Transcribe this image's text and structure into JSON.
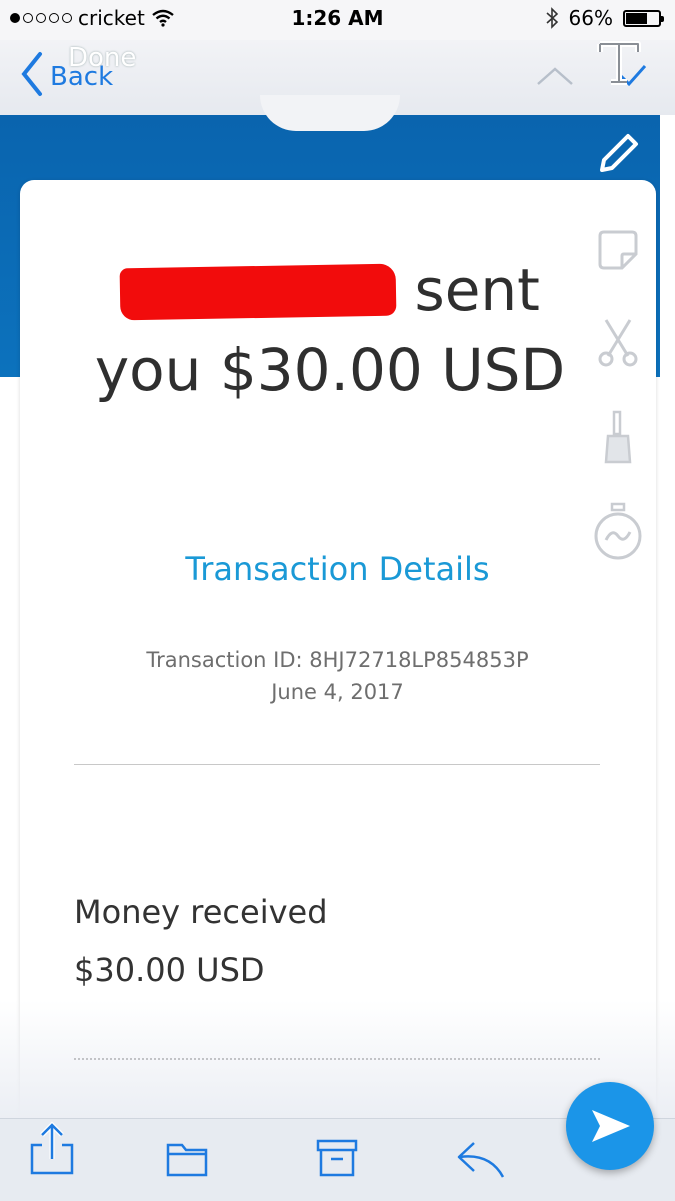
{
  "status_bar": {
    "carrier": "cricket",
    "time": "1:26 AM",
    "battery": "66%",
    "battery_level": 0.66
  },
  "nav": {
    "back_label": "Back",
    "done_label": "Done"
  },
  "payment": {
    "headline_line1_suffix": "sent",
    "headline_line2": "you $30.00 USD",
    "transaction_details_link": "Transaction Details",
    "transaction_id": "Transaction ID: 8HJ72718LP854853P",
    "date": "June 4, 2017",
    "money_received_label": "Money received",
    "money_received_amount": "$30.00 USD"
  },
  "colors": {
    "paypal_blue": "#0a64ae",
    "link_blue": "#1a99d6",
    "redaction": "#f20c0c",
    "send_button": "#1b95e8"
  },
  "icons": {
    "markup_tools": [
      "text-tool-icon",
      "pencil-icon",
      "sticker-icon",
      "scissors-icon",
      "brush-icon",
      "timer-icon"
    ],
    "toolbar": [
      "share-icon",
      "folder-icon",
      "archive-icon",
      "reply-icon",
      "send-icon"
    ]
  }
}
